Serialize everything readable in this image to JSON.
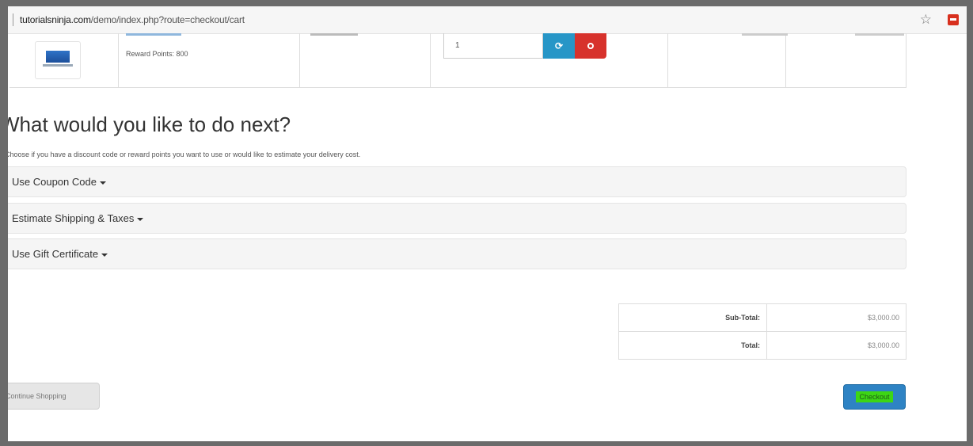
{
  "browser": {
    "url_host": "tutorialsninja.com",
    "url_path": "/demo/index.php?route=checkout/cart",
    "bookmark_icon": "star-icon",
    "extension_icon": "extension-icon"
  },
  "cart": {
    "reward_points": "Reward Points: 800",
    "quantity": "1",
    "update_icon": "refresh-icon",
    "remove_icon": "remove-icon"
  },
  "next": {
    "heading": "What would you like to do next?",
    "description": "Choose if you have a discount code or reward points you want to use or would like to estimate your delivery cost.",
    "panels": [
      {
        "title": "Use Coupon Code"
      },
      {
        "title": "Estimate Shipping & Taxes"
      },
      {
        "title": "Use Gift Certificate"
      }
    ]
  },
  "totals": [
    {
      "label": "Sub-Total:",
      "value": "$3,000.00"
    },
    {
      "label": "Total:",
      "value": "$3,000.00"
    }
  ],
  "buttons": {
    "continue": "Continue Shopping",
    "checkout": "Checkout"
  },
  "colors": {
    "update_button": "#2796c7",
    "remove_button": "#d7322c",
    "checkout_button": "#2e83c4",
    "checkout_highlight": "#3dd615"
  }
}
